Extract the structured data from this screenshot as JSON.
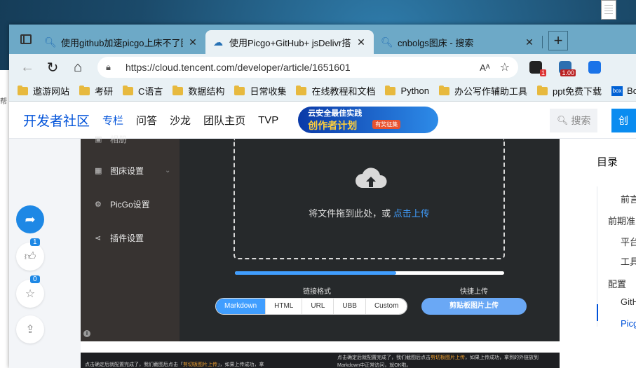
{
  "browser": {
    "tabs": [
      {
        "title": "使用github加速picgo上床不了图",
        "active": false
      },
      {
        "title": "使用Picgo+GitHub+ jsDelivr搭建",
        "active": true
      },
      {
        "title": "cnbolgs图床 - 搜索",
        "active": false
      }
    ],
    "url": "https://cloud.tencent.com/developer/article/1651601",
    "read_aloud": "Aᴬ",
    "extensions": {
      "badge_count": "1",
      "version_badge": "1.00"
    }
  },
  "bookmarks": [
    "遨游网站",
    "考研",
    "C语言",
    "数据结构",
    "日常收集",
    "在线教程和文档",
    "Python",
    "办公写作辅助工具",
    "ppt免费下载",
    "Bo"
  ],
  "left_strip": {
    "text": "帮"
  },
  "site": {
    "logo": "开发者社区",
    "nav": [
      {
        "label": "专栏",
        "active": true
      },
      {
        "label": "问答",
        "active": false
      },
      {
        "label": "沙龙",
        "active": false
      },
      {
        "label": "团队主页",
        "active": false
      },
      {
        "label": "TVP",
        "active": false
      }
    ],
    "banner": {
      "line1": "云安全最佳实践",
      "line2": "创作者计划",
      "tag": "有奖征集"
    },
    "search_placeholder": "搜索",
    "create_label": "创"
  },
  "float": {
    "like_count": "1",
    "star_count": "0"
  },
  "picgo": {
    "menu": [
      {
        "label": "相册",
        "icon": "image-icon"
      },
      {
        "label": "图床设置",
        "icon": "grid-icon"
      },
      {
        "label": "PicGo设置",
        "icon": "gear-icon"
      },
      {
        "label": "插件设置",
        "icon": "share-icon"
      }
    ],
    "drop_text": "将文件拖到此处，或 ",
    "drop_link": "点击上传",
    "progress": 0.6,
    "link_format_label": "链接格式",
    "quick_upload_label": "快捷上传",
    "formats": [
      {
        "label": "Markdown",
        "active": true
      },
      {
        "label": "HTML",
        "active": false
      },
      {
        "label": "URL",
        "active": false
      },
      {
        "label": "UBB",
        "active": false
      },
      {
        "label": "Custom",
        "active": false
      }
    ],
    "clipboard_button": "剪贴板图片上传"
  },
  "second_shot": {
    "left_pre": "点击确定后就配置完成了，我们截图后点击「",
    "left_hl": "剪切板图片上传",
    "left_post": "」，如果上传成功，拿",
    "right_pre": "点击确定后就配置完成了，我们截图后点击",
    "right_hl": "剪切板图片上传",
    "right_post": "，如果上传成功，拿到的外链放到Markdown中正常访问，就OK啦。"
  },
  "toc": {
    "title": "目录",
    "items": [
      {
        "label": "前言",
        "level": 2,
        "active": false
      },
      {
        "label": "前期准",
        "level": 1,
        "active": false
      },
      {
        "label": "平台",
        "level": 2,
        "active": false
      },
      {
        "label": "工具",
        "level": 2,
        "active": false
      },
      {
        "label": "配置",
        "level": 1,
        "active": false
      },
      {
        "label": "GitH",
        "level": 2,
        "active": false
      },
      {
        "label": "Picg",
        "level": 2,
        "active": true
      }
    ]
  }
}
